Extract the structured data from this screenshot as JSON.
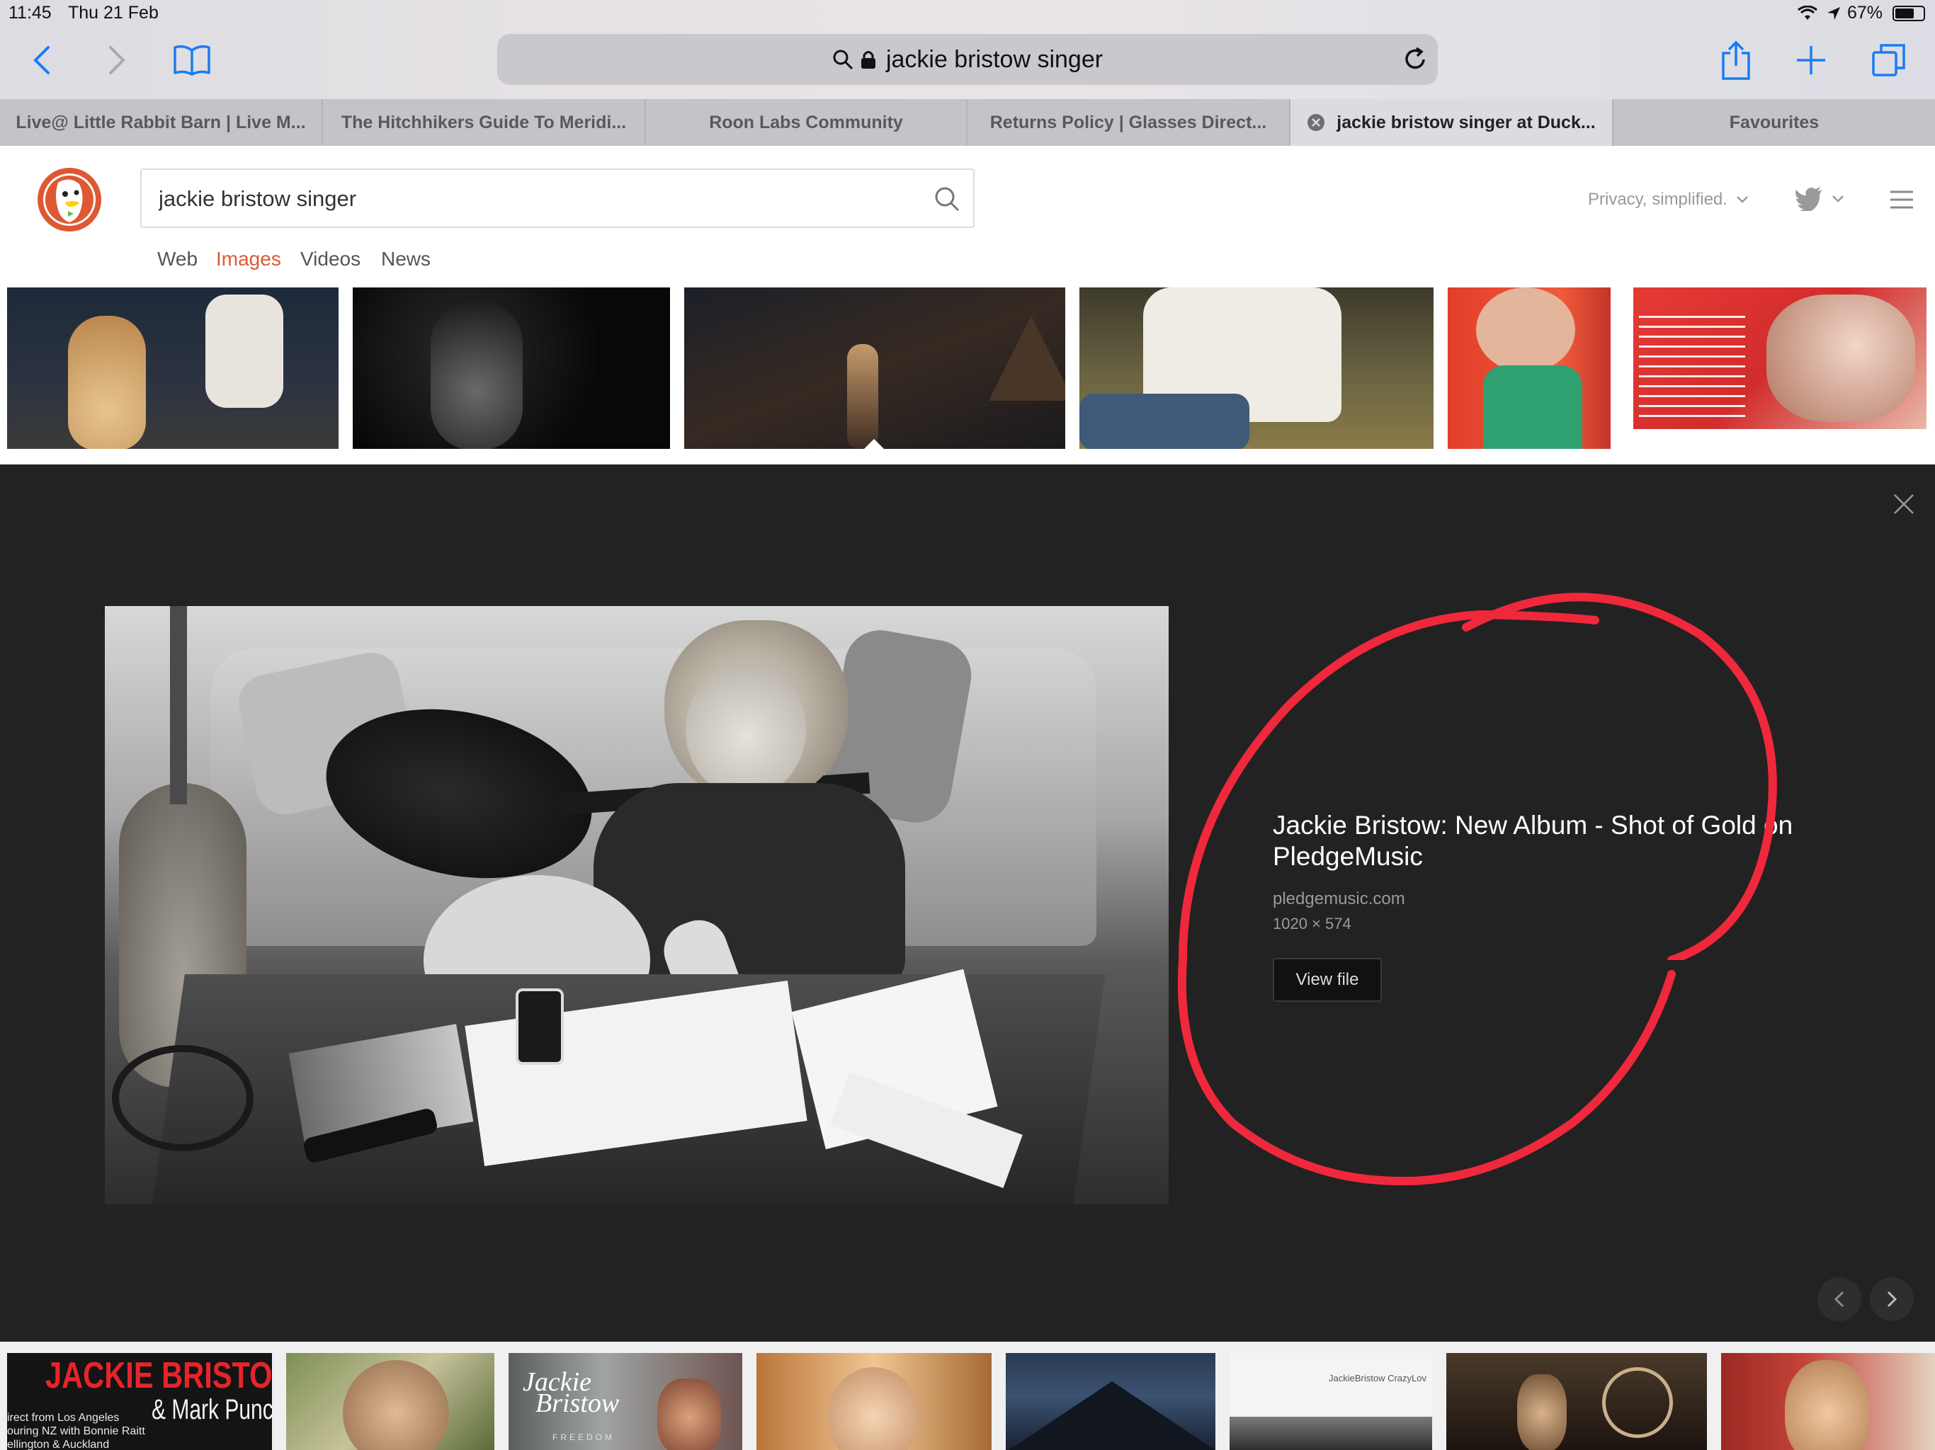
{
  "status_bar": {
    "time": "11:45",
    "date": "Thu 21 Feb",
    "battery": "67%"
  },
  "toolbar": {
    "address_text": "jackie bristow singer"
  },
  "tabs": [
    {
      "label": "Live@ Little Rabbit Barn | Live M..."
    },
    {
      "label": "The Hitchhikers Guide To Meridi..."
    },
    {
      "label": "Roon Labs Community"
    },
    {
      "label": "Returns Policy | Glasses Direct..."
    },
    {
      "label": "jackie bristow singer at Duck..."
    },
    {
      "label": "Favourites"
    }
  ],
  "ddg": {
    "search_value": "jackie bristow singer",
    "privacy_label": "Privacy, simplified.",
    "nav": [
      "Web",
      "Images",
      "Videos",
      "News"
    ],
    "accent_color": "#de5833"
  },
  "detail": {
    "title": "Jackie Bristow: New Album - Shot of Gold on PledgeMusic",
    "domain": "pledgemusic.com",
    "dimensions": "1020 × 574",
    "view_file_label": "View file"
  },
  "thumbnails_top": [
    {
      "alt": "woman with acoustic guitar"
    },
    {
      "alt": "black and white portrait"
    },
    {
      "alt": "woman on hill at dusk"
    },
    {
      "alt": "woman in white shirt"
    },
    {
      "alt": "woman in green dress"
    },
    {
      "alt": "tour poster"
    }
  ],
  "thumbnails_bottom": [
    {
      "alt": "concert poster",
      "text_main": "JACKIE BRISTOW",
      "text_sub": "& Mark Punc",
      "lines": [
        "irect from Los Angeles",
        "ouring NZ with Bonnie Raitt",
        "ellington & Auckland"
      ]
    },
    {
      "alt": "woman portrait outdoors"
    },
    {
      "alt": "album cover",
      "text_main": "Jackie",
      "text_sub": "Bristow",
      "lines": [
        "FREEDOM"
      ]
    },
    {
      "alt": "close-up portrait"
    },
    {
      "alt": "mountain silhouette"
    },
    {
      "alt": "album cover crazy love",
      "text_main": "JackieBristow CrazyLov"
    },
    {
      "alt": "singer on stage"
    },
    {
      "alt": "woman with guitar"
    }
  ],
  "annotation_color": "#f0283c"
}
